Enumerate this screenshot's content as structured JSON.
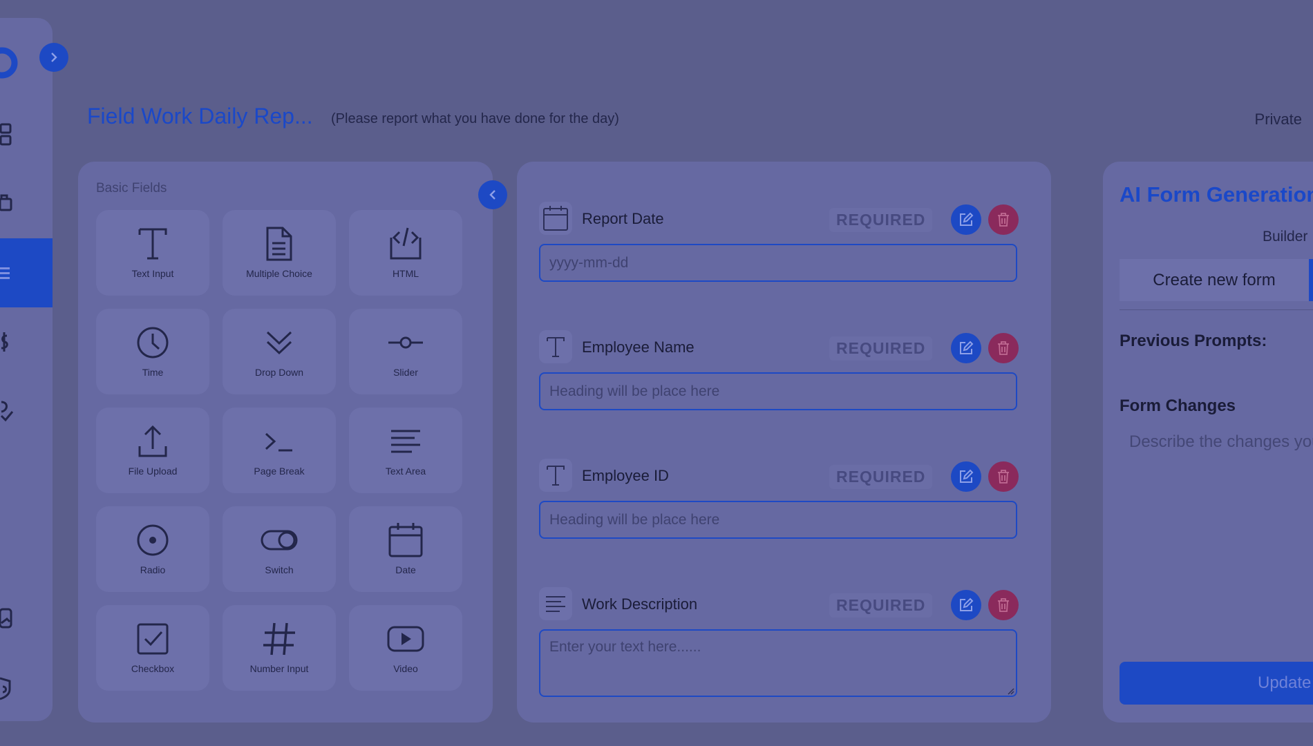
{
  "header": {
    "form_title": "Field Work Daily Rep...",
    "form_subtitle": "(Please report what you have done for the day)",
    "privacy": "Private"
  },
  "fields_panel": {
    "heading": "Basic Fields",
    "fields": [
      {
        "label": "Text Input",
        "icon": "text-input-icon"
      },
      {
        "label": "Multiple Choice",
        "icon": "document-icon"
      },
      {
        "label": "HTML",
        "icon": "code-icon"
      },
      {
        "label": "Time",
        "icon": "clock-icon"
      },
      {
        "label": "Drop Down",
        "icon": "chevron-down-icon"
      },
      {
        "label": "Slider",
        "icon": "slider-icon"
      },
      {
        "label": "File Upload",
        "icon": "upload-icon"
      },
      {
        "label": "Page Break",
        "icon": "terminal-icon"
      },
      {
        "label": "Text Area",
        "icon": "text-lines-icon"
      },
      {
        "label": "Radio",
        "icon": "radio-icon"
      },
      {
        "label": "Switch",
        "icon": "switch-icon"
      },
      {
        "label": "Date",
        "icon": "calendar-icon"
      },
      {
        "label": "Checkbox",
        "icon": "checkbox-icon"
      },
      {
        "label": "Number Input",
        "icon": "hash-icon"
      },
      {
        "label": "Video",
        "icon": "video-icon"
      }
    ]
  },
  "builder": {
    "questions": [
      {
        "label": "Report Date",
        "required": "REQUIRED",
        "placeholder": "yyyy-mm-dd",
        "icon": "calendar-icon",
        "type": "date"
      },
      {
        "label": "Employee Name",
        "required": "REQUIRED",
        "placeholder": "Heading will be place here",
        "icon": "text-input-icon",
        "type": "text"
      },
      {
        "label": "Employee ID",
        "required": "REQUIRED",
        "placeholder": "Heading will be place here",
        "icon": "text-input-icon",
        "type": "text"
      },
      {
        "label": "Work Description",
        "required": "REQUIRED",
        "placeholder": "Enter your text here......",
        "icon": "text-lines-icon",
        "type": "textarea"
      }
    ]
  },
  "ai_panel": {
    "title": "AI Form Generation",
    "tab_builder": "Builder",
    "tab_create": "Create new form",
    "previous_prompts_label": "Previous Prompts:",
    "form_changes_label": "Form Changes",
    "changes_placeholder": "Describe the changes you",
    "update_button": "Update"
  },
  "colors": {
    "accent": "#1d49c4",
    "delete": "#8a2a5c",
    "overlay_background": "#5b5e8c"
  }
}
